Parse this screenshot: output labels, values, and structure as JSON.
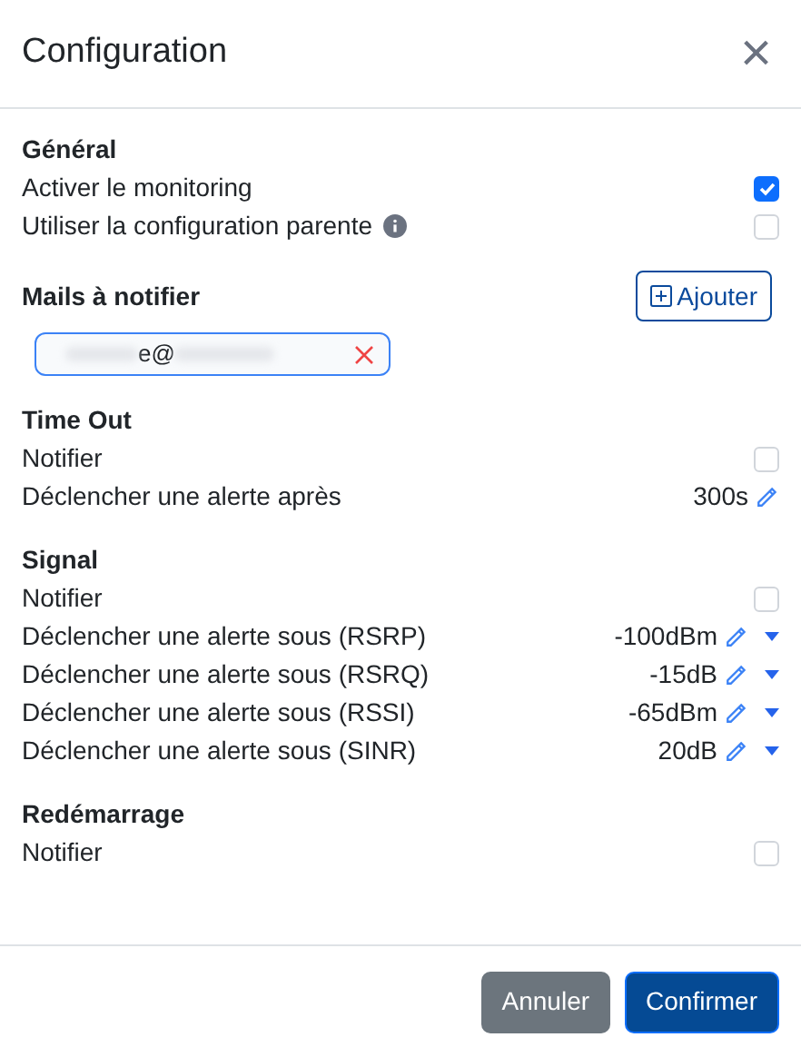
{
  "dialog": {
    "title": "Configuration",
    "close": "×"
  },
  "sections": [
    {
      "title": "Général",
      "rows": [
        {
          "kind": "checkbox",
          "label": "Activer le monitoring",
          "checked": true
        },
        {
          "kind": "checkbox",
          "label": "Utiliser la configuration parente",
          "checked": false,
          "info": true
        }
      ]
    },
    {
      "title": "Mails à notifier",
      "add_button": "Ajouter",
      "emails": [
        {
          "visible_text": "e@"
        }
      ]
    },
    {
      "title": "Time Out",
      "rows": [
        {
          "kind": "checkbox",
          "label": "Notifier",
          "checked": false
        },
        {
          "kind": "value",
          "label": "Déclencher une alerte après",
          "value": "300s"
        }
      ]
    },
    {
      "title": "Signal",
      "rows": [
        {
          "kind": "checkbox",
          "label": "Notifier",
          "checked": false
        },
        {
          "kind": "dropdown",
          "label": "Déclencher une alerte sous (RSRP)",
          "value": "-100dBm"
        },
        {
          "kind": "dropdown",
          "label": "Déclencher une alerte sous (RSRQ)",
          "value": "-15dB"
        },
        {
          "kind": "dropdown",
          "label": "Déclencher une alerte sous (RSSI)",
          "value": "-65dBm"
        },
        {
          "kind": "dropdown",
          "label": "Déclencher une alerte sous (SINR)",
          "value": "20dB"
        }
      ]
    },
    {
      "title": "Redémarrage",
      "rows": [
        {
          "kind": "checkbox",
          "label": "Notifier",
          "checked": false
        }
      ]
    }
  ],
  "buttons": [
    {
      "label": "Annuler",
      "kind": "secondary"
    },
    {
      "label": "Confirmer",
      "kind": "primary"
    }
  ]
}
